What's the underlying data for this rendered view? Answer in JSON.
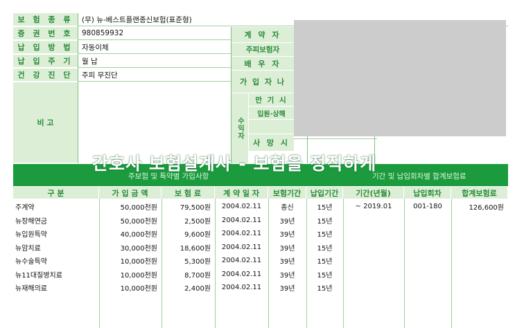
{
  "info_labels": {
    "insurance_type": "보 험 종 류",
    "policy_number": "증 권 번 호",
    "payment_method": "납 입 방 법",
    "payment_cycle": "납 입 주 기",
    "health_check": "건 강 진 단",
    "remarks": "비      고"
  },
  "info_values": {
    "insurance_type": "(무) 뉴-베스트플랜종신보험(표준형)",
    "policy_number": "980859932",
    "payment_method": "자동이체",
    "payment_cycle": "월 납",
    "health_check": "주피 무진단"
  },
  "right_labels": {
    "contractor": "계  약  자",
    "insured": "주피보험자",
    "spouse": "배  우  자",
    "subscriber": "가 입 자 나",
    "maturity": "만 기 시",
    "hospital": "입원·상해",
    "beneficiary": "수익자",
    "death": "사 망 시"
  },
  "banner": {
    "title": "간호사 보험설계사 - 보험을 정직하게",
    "sub_left": "주보험 및 특약별 가입사항",
    "sub_right": "기간 및 납입회차별 합계보험료"
  },
  "table": {
    "headers": [
      "구        분",
      "가 입 금 액",
      "보 험 료",
      "계 약 일 자",
      "보험기간",
      "납입기간",
      "기간(년월)",
      "납입회차",
      "합계보험료"
    ],
    "rows": [
      [
        "주계약",
        "50,000천원",
        "79,500원",
        "2004.02.11",
        "종신",
        "15년",
        "~ 2019.01",
        "001-180",
        "126,600원"
      ],
      [
        "뉴장해연금",
        "50,000천원",
        "2,500원",
        "2004.02.11",
        "39년",
        "15년",
        "",
        "",
        ""
      ],
      [
        "뉴입원특약",
        "40,000천원",
        "9,600원",
        "2004.02.11",
        "39년",
        "15년",
        "",
        "",
        ""
      ],
      [
        "뉴암치료",
        "30,000천원",
        "18,600원",
        "2004.02.11",
        "39년",
        "15년",
        "",
        "",
        ""
      ],
      [
        "뉴수술특약",
        "10,000천원",
        "5,300원",
        "2004.02.11",
        "39년",
        "15년",
        "",
        "",
        ""
      ],
      [
        "뉴11대질병치료",
        "10,000천원",
        "8,700원",
        "2004.02.11",
        "39년",
        "15년",
        "",
        "",
        ""
      ],
      [
        "뉴재해의료",
        "10,000천원",
        "2,400원",
        "2004.02.11",
        "39년",
        "15년",
        "",
        "",
        ""
      ]
    ]
  },
  "colors": {
    "label_bg": "#dcefd6",
    "label_text": "#2a8a3a",
    "banner_green": "#1c9b3e",
    "redaction_gray": "#cccccc"
  }
}
